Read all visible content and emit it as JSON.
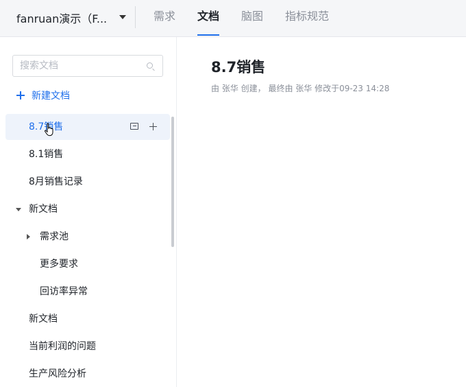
{
  "header": {
    "project_name": "fanruan演示（F...",
    "tabs": [
      {
        "label": "需求",
        "active": false
      },
      {
        "label": "文档",
        "active": true
      },
      {
        "label": "脑图",
        "active": false
      },
      {
        "label": "指标规范",
        "active": false
      }
    ]
  },
  "sidebar": {
    "search_placeholder": "搜索文档",
    "new_doc_label": "新建文档",
    "items": [
      {
        "label": "8.7销售",
        "level": 0,
        "active": true
      },
      {
        "label": "8.1销售",
        "level": 0
      },
      {
        "label": "8月销售记录",
        "level": 0
      },
      {
        "label": "新文档",
        "level": 0,
        "expanded": true
      },
      {
        "label": "需求池",
        "level": 1,
        "collapsed": true
      },
      {
        "label": "更多要求",
        "level": 2
      },
      {
        "label": "回访率异常",
        "level": 2
      },
      {
        "label": "新文档",
        "level": 0
      },
      {
        "label": "当前利润的问题",
        "level": 0
      },
      {
        "label": "生产风险分析",
        "level": 0
      }
    ]
  },
  "document": {
    "title": "8.7销售",
    "meta": "由 张华 创建， 最终由 张华 修改于09-23 14:28"
  },
  "colors": {
    "accent": "#1f6feb",
    "active_bg": "#eef3fb"
  }
}
